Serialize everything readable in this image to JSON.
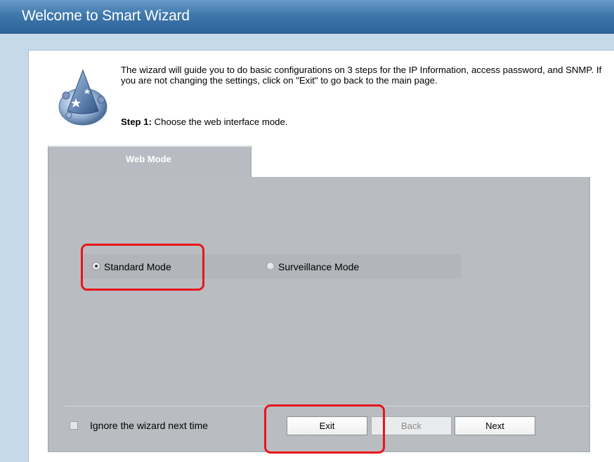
{
  "window": {
    "title": "Welcome to Smart Wizard"
  },
  "intro": {
    "text": "The wizard will guide you to do basic configurations on 3 steps for the IP Information, access password, and SNMP. If you are not changing the settings, click on \"Exit\" to go back to the main page.",
    "step_label": "Step 1:",
    "step_text": " Choose the web interface mode."
  },
  "tab": {
    "label": "Web Mode"
  },
  "modes": {
    "standard": {
      "label": "Standard Mode",
      "selected": true
    },
    "surveillance": {
      "label": "Surveillance Mode",
      "selected": false
    }
  },
  "footer": {
    "ignore_label": "Ignore the wizard next time",
    "ignore_checked": false,
    "exit_label": "Exit",
    "back_label": "Back",
    "next_label": "Next"
  },
  "colors": {
    "titlebar": "#3f78ad",
    "background": "#c6d9ea",
    "highlight": "#e8151b"
  },
  "icons": [
    "wizard-hat-icon"
  ]
}
